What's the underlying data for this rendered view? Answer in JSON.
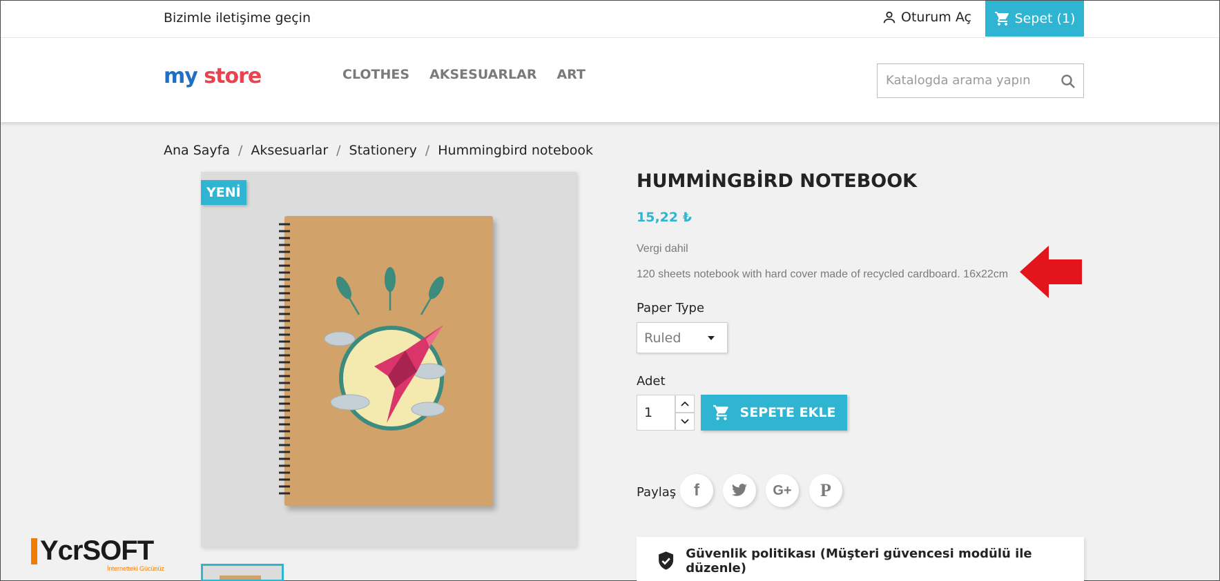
{
  "topbar": {
    "contact_label": "Bizimle iletişime geçin",
    "signin_label": "Oturum Aç",
    "cart_label": "Sepet (1)"
  },
  "header": {
    "logo_part1": "my",
    "logo_part2": "store",
    "nav": [
      "CLOTHES",
      "AKSESUARLAR",
      "ART"
    ],
    "search_placeholder": "Katalogda arama yapın"
  },
  "breadcrumb": [
    "Ana Sayfa",
    "Aksesuarlar",
    "Stationery",
    "Hummingbird notebook"
  ],
  "product": {
    "badge": "YENİ",
    "title": "HUMMİNGBİRD NOTEBOOK",
    "price": "15,22 ₺",
    "tax_note": "Vergi dahil",
    "description": "120 sheets notebook with hard cover made of recycled cardboard. 16x22cm",
    "paper_type_label": "Paper Type",
    "paper_type_value": "Ruled",
    "quantity_label": "Adet",
    "quantity_value": "1",
    "add_to_cart_label": "SEPETE EKLE"
  },
  "share": {
    "label": "Paylaş",
    "networks": [
      "facebook",
      "twitter",
      "google-plus",
      "pinterest"
    ]
  },
  "security": {
    "text": "Güvenlik politikası (Müşteri güvencesi modülü ile düzenle)"
  },
  "watermark": {
    "brand": "YcrSOFT",
    "tagline": "İnternetteki Gücünüz"
  },
  "colors": {
    "accent": "#2fb5d2",
    "arrow": "#e3141c",
    "watermark_orange": "#f07d00"
  }
}
